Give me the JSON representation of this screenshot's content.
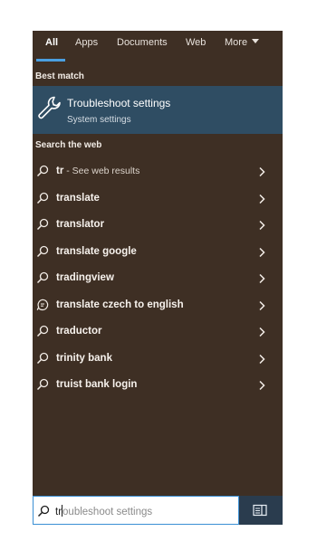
{
  "tabs": [
    {
      "label": "All"
    },
    {
      "label": "Apps"
    },
    {
      "label": "Documents"
    },
    {
      "label": "Web"
    },
    {
      "label": "More"
    }
  ],
  "best_match": {
    "section_label": "Best match",
    "title": "Troubleshoot settings",
    "subtitle": "System settings",
    "icon": "wrench-icon"
  },
  "web": {
    "section_label": "Search the web",
    "items": [
      {
        "label": "tr",
        "suffix": " - See web results",
        "icon": "search-icon"
      },
      {
        "label": "translate",
        "suffix": "",
        "icon": "search-icon"
      },
      {
        "label": "translator",
        "suffix": "",
        "icon": "search-icon"
      },
      {
        "label": "translate google",
        "suffix": "",
        "icon": "search-icon"
      },
      {
        "label": "tradingview",
        "suffix": "",
        "icon": "search-icon"
      },
      {
        "label": "translate czech to english",
        "suffix": "",
        "icon": "chat-bubble-icon"
      },
      {
        "label": "traductor",
        "suffix": "",
        "icon": "search-icon"
      },
      {
        "label": "trinity bank",
        "suffix": "",
        "icon": "search-icon"
      },
      {
        "label": "truist bank login",
        "suffix": "",
        "icon": "search-icon"
      }
    ]
  },
  "search": {
    "typed": "tr",
    "suggestion": "oubleshoot settings"
  },
  "colors": {
    "panel_bg": "#3e2f24",
    "selected_bg": "#2f4d63",
    "accent": "#4a9fe0"
  }
}
